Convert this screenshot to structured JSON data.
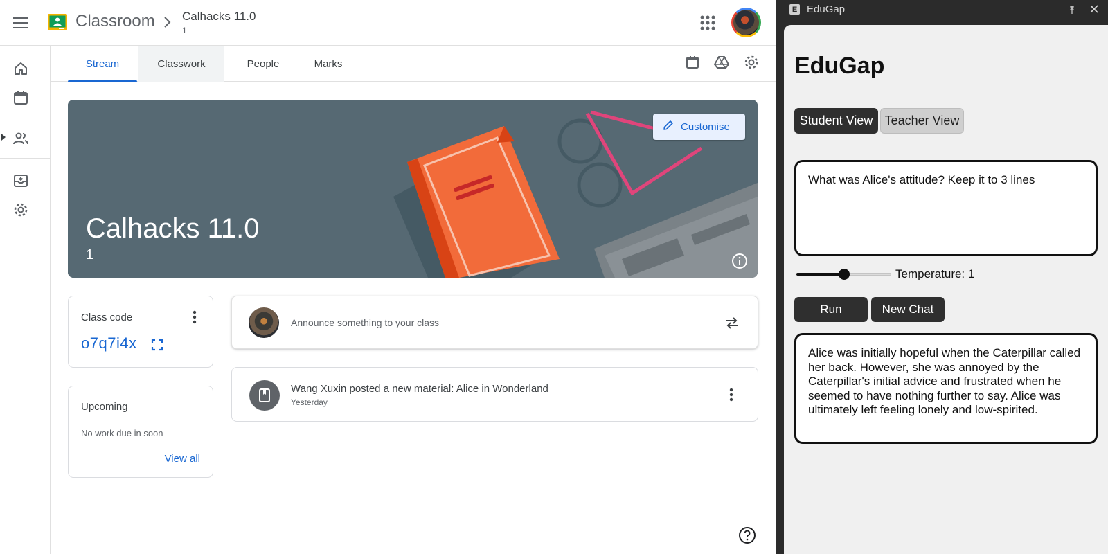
{
  "classroom": {
    "app_name": "Classroom",
    "course": {
      "title": "Calhacks 11.0",
      "section": "1"
    },
    "tabs": [
      {
        "label": "Stream",
        "active": true
      },
      {
        "label": "Classwork",
        "active": false
      },
      {
        "label": "People",
        "active": false
      },
      {
        "label": "Marks",
        "active": false
      }
    ],
    "banner": {
      "title": "Calhacks 11.0",
      "section": "1",
      "customise_label": "Customise"
    },
    "class_code": {
      "label": "Class code",
      "code": "o7q7i4x"
    },
    "upcoming": {
      "title": "Upcoming",
      "empty_text": "No work due in soon",
      "view_all": "View all"
    },
    "announce": {
      "placeholder": "Announce something to your class"
    },
    "post": {
      "title": "Wang Xuxin posted a new material: Alice in Wonderland",
      "time": "Yesterday"
    },
    "icons": {
      "menu": "menu-icon",
      "logo": "classroom-logo",
      "chevron": "chevron-right-icon",
      "apps": "apps-grid-icon",
      "home": "home-icon",
      "calendar": "calendar-icon",
      "people": "people-icon",
      "archive": "archive-icon",
      "settings": "gear-icon",
      "drive": "drive-icon",
      "info": "info-icon",
      "more": "more-vert-icon",
      "repost": "repost-icon",
      "material": "material-icon",
      "help": "help-icon",
      "edit": "pencil-icon",
      "expand": "fullscreen-icon"
    },
    "colors": {
      "accent": "#1967d2",
      "banner": "#566973",
      "book": "#f26b3a"
    }
  },
  "edugap": {
    "window_title": "EduGap",
    "window_icon_letter": "E",
    "heading": "EduGap",
    "views": {
      "student": "Student View",
      "teacher": "Teacher View",
      "active": "student"
    },
    "prompt": "What was Alice's attitude? Keep it to 3 lines",
    "temperature": {
      "label": "Temperature: 1",
      "value": 1,
      "min": 0,
      "max": 2
    },
    "buttons": {
      "run": "Run",
      "new_chat": "New Chat"
    },
    "response": "Alice was initially hopeful when the Caterpillar called her back. However, she was annoyed by the Caterpillar's initial advice and frustrated when he seemed to have nothing further to say. Alice was ultimately left feeling lonely and low-spirited."
  }
}
